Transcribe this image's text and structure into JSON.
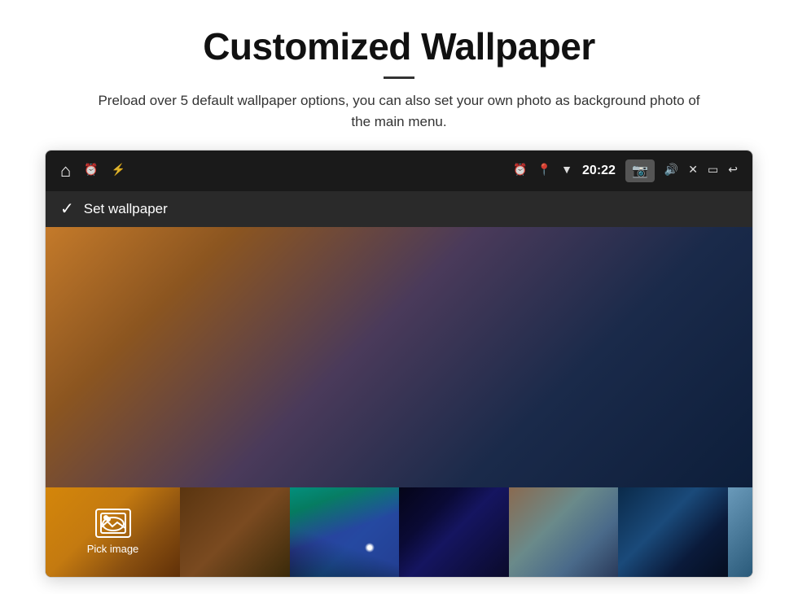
{
  "page": {
    "title": "Customized Wallpaper",
    "divider": true,
    "subtitle": "Preload over 5 default wallpaper options, you can also set your own photo as background photo of the main menu."
  },
  "device": {
    "statusBar": {
      "leftIcons": [
        "home",
        "alarm",
        "usb"
      ],
      "rightIcons": [
        "alarm",
        "location",
        "wifi",
        "time",
        "camera",
        "volume",
        "close",
        "window",
        "back"
      ],
      "time": "20:22"
    },
    "toolbar": {
      "checkmark": "✓",
      "label": "Set wallpaper"
    },
    "thumbnails": {
      "pickLabel": "Pick image"
    }
  }
}
